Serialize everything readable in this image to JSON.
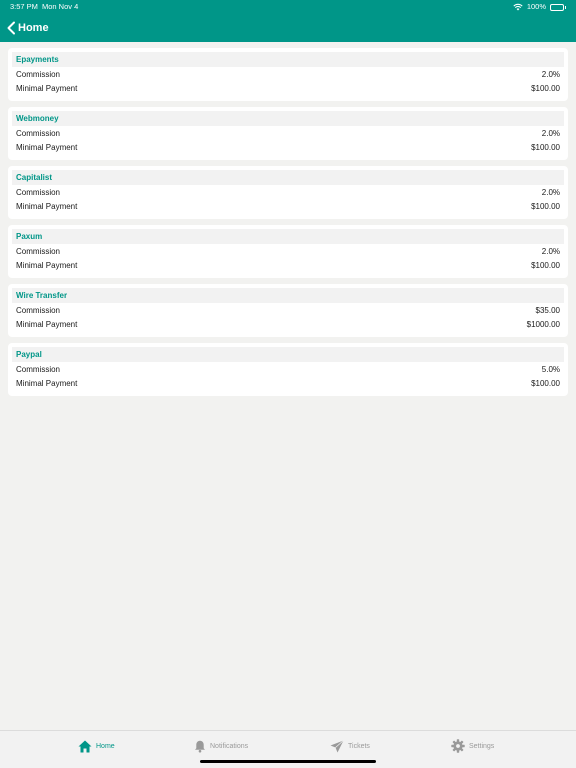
{
  "status_bar": {
    "time": "3:57 PM",
    "date": "Mon Nov 4",
    "battery": "100%"
  },
  "nav": {
    "back_label": "Home"
  },
  "payment_methods": [
    {
      "name": "Epayments",
      "rows": [
        {
          "label": "Commission",
          "value": "2.0%"
        },
        {
          "label": "Minimal Payment",
          "value": "$100.00"
        }
      ]
    },
    {
      "name": "Webmoney",
      "rows": [
        {
          "label": "Commission",
          "value": "2.0%"
        },
        {
          "label": "Minimal Payment",
          "value": "$100.00"
        }
      ]
    },
    {
      "name": "Capitalist",
      "rows": [
        {
          "label": "Commission",
          "value": "2.0%"
        },
        {
          "label": "Minimal Payment",
          "value": "$100.00"
        }
      ]
    },
    {
      "name": "Paxum",
      "rows": [
        {
          "label": "Commission",
          "value": "2.0%"
        },
        {
          "label": "Minimal Payment",
          "value": "$100.00"
        }
      ]
    },
    {
      "name": "Wire Transfer",
      "rows": [
        {
          "label": "Commission",
          "value": "$35.00"
        },
        {
          "label": "Minimal Payment",
          "value": "$1000.00"
        }
      ]
    },
    {
      "name": "Paypal",
      "rows": [
        {
          "label": "Commission",
          "value": "5.0%"
        },
        {
          "label": "Minimal Payment",
          "value": "$100.00"
        }
      ]
    }
  ],
  "tab_bar": {
    "tabs": [
      {
        "label": "Home",
        "icon": "home-icon",
        "active": true
      },
      {
        "label": "Notifications",
        "icon": "bell-icon",
        "active": false
      },
      {
        "label": "Tickets",
        "icon": "paper-plane-icon",
        "active": false
      },
      {
        "label": "Settings",
        "icon": "gear-icon",
        "active": false
      }
    ]
  },
  "colors": {
    "accent": "#009688",
    "background": "#f2f2f0",
    "inactive": "#9a9a9a"
  }
}
